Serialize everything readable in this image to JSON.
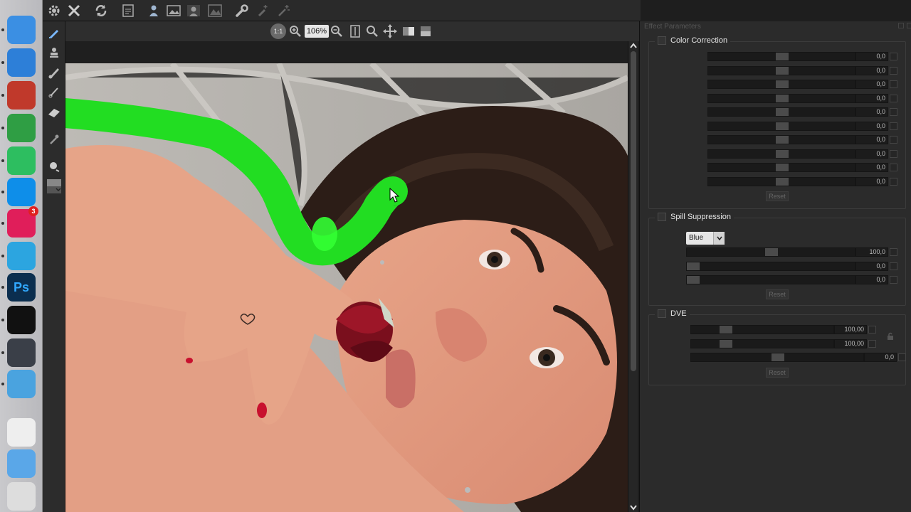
{
  "dock": {
    "apps": [
      {
        "name": "finder-icon",
        "color": "#3b8fe3"
      },
      {
        "name": "safari-icon",
        "color": "#2d7fd8"
      },
      {
        "name": "photo-booth-icon",
        "color": "#c0392b"
      },
      {
        "name": "chrome-icon",
        "color": "#2f9e44"
      },
      {
        "name": "evernote-icon",
        "color": "#2dbe60"
      },
      {
        "name": "teamviewer-icon",
        "color": "#0e8ee9"
      },
      {
        "name": "slack-icon",
        "color": "#e01e5a",
        "badge": "3"
      },
      {
        "name": "telegram-icon",
        "color": "#2ca5e0"
      },
      {
        "name": "photoshop-icon",
        "color": "#0b2e4f",
        "glyph": "Ps"
      },
      {
        "name": "terminal-icon",
        "color": "#111111"
      },
      {
        "name": "quicktime-icon",
        "color": "#3a3f48"
      },
      {
        "name": "testflight-icon",
        "color": "#4aa3df"
      },
      {
        "name": "document-icon",
        "color": "#eeeeee"
      },
      {
        "name": "folder-icon",
        "color": "#5aa7e8"
      },
      {
        "name": "trash-icon",
        "color": "#dddddd"
      }
    ]
  },
  "view_toolbar": {
    "zoom_button_label": "1:1",
    "zoom_level": "106%"
  },
  "effect_panel": {
    "title": "Effect Parameters",
    "color_correction": {
      "label": "Color Correction",
      "values": [
        "0,0",
        "0,0",
        "0,0",
        "0,0",
        "0,0",
        "0,0",
        "0,0",
        "0,0",
        "0,0",
        "0,0"
      ],
      "reset_label": "Reset"
    },
    "spill_suppression": {
      "label": "Spill Suppression",
      "mode": "Blue",
      "values": [
        "100,0",
        "0,0",
        "0,0"
      ],
      "reset_label": "Reset"
    },
    "dve": {
      "label": "DVE",
      "values": [
        "100,00",
        "100,00",
        "0,0"
      ],
      "reset_label": "Reset"
    }
  },
  "colors": {
    "mask_stroke": "#22dd22",
    "panel_bg": "#2b2b2b"
  }
}
